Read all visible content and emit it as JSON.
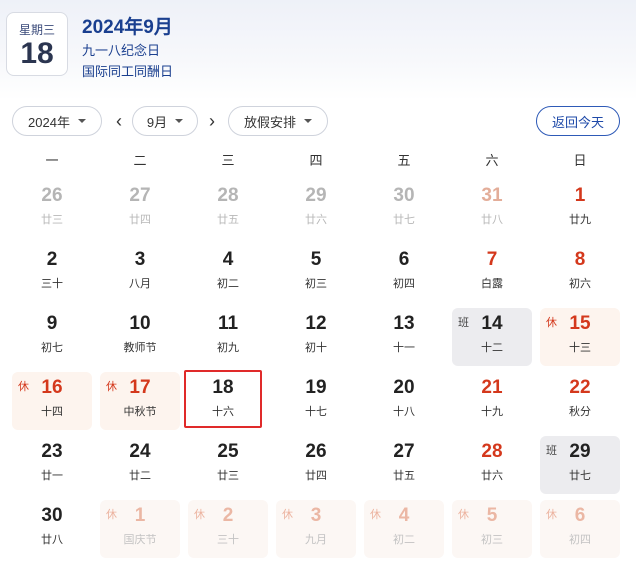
{
  "header": {
    "weekday": "星期三",
    "day": "18",
    "title": "2024年9月",
    "events": [
      "九一八纪念日",
      "国际同工同酬日"
    ]
  },
  "controls": {
    "year": "2024年",
    "month": "9月",
    "holiday": "放假安排",
    "prev": "‹",
    "next": "›",
    "today_button": "返回今天"
  },
  "weekdays": [
    "一",
    "二",
    "三",
    "四",
    "五",
    "六",
    "日"
  ],
  "days": [
    {
      "n": "26",
      "s": "廿三",
      "type": "other"
    },
    {
      "n": "27",
      "s": "廿四",
      "type": "other"
    },
    {
      "n": "28",
      "s": "廿五",
      "type": "other"
    },
    {
      "n": "29",
      "s": "廿六",
      "type": "other"
    },
    {
      "n": "30",
      "s": "廿七",
      "type": "other"
    },
    {
      "n": "31",
      "s": "廿八",
      "type": "other red"
    },
    {
      "n": "1",
      "s": "廿九",
      "type": "red"
    },
    {
      "n": "2",
      "s": "三十",
      "type": ""
    },
    {
      "n": "3",
      "s": "八月",
      "type": ""
    },
    {
      "n": "4",
      "s": "初二",
      "type": ""
    },
    {
      "n": "5",
      "s": "初三",
      "type": ""
    },
    {
      "n": "6",
      "s": "初四",
      "type": ""
    },
    {
      "n": "7",
      "s": "白露",
      "type": "red"
    },
    {
      "n": "8",
      "s": "初六",
      "type": "red"
    },
    {
      "n": "9",
      "s": "初七",
      "type": ""
    },
    {
      "n": "10",
      "s": "教师节",
      "type": ""
    },
    {
      "n": "11",
      "s": "初九",
      "type": ""
    },
    {
      "n": "12",
      "s": "初十",
      "type": ""
    },
    {
      "n": "13",
      "s": "十一",
      "type": ""
    },
    {
      "n": "14",
      "s": "十二",
      "type": "work",
      "tag": "班"
    },
    {
      "n": "15",
      "s": "十三",
      "type": "rest",
      "tag": "休"
    },
    {
      "n": "16",
      "s": "十四",
      "type": "rest",
      "tag": "休"
    },
    {
      "n": "17",
      "s": "中秋节",
      "type": "rest",
      "tag": "休"
    },
    {
      "n": "18",
      "s": "十六",
      "type": "today"
    },
    {
      "n": "19",
      "s": "十七",
      "type": ""
    },
    {
      "n": "20",
      "s": "十八",
      "type": ""
    },
    {
      "n": "21",
      "s": "十九",
      "type": "red"
    },
    {
      "n": "22",
      "s": "秋分",
      "type": "red"
    },
    {
      "n": "23",
      "s": "廿一",
      "type": ""
    },
    {
      "n": "24",
      "s": "廿二",
      "type": ""
    },
    {
      "n": "25",
      "s": "廿三",
      "type": ""
    },
    {
      "n": "26",
      "s": "廿四",
      "type": ""
    },
    {
      "n": "27",
      "s": "廿五",
      "type": ""
    },
    {
      "n": "28",
      "s": "廿六",
      "type": "red"
    },
    {
      "n": "29",
      "s": "廿七",
      "type": "work",
      "tag": "班"
    },
    {
      "n": "30",
      "s": "廿八",
      "type": ""
    },
    {
      "n": "1",
      "s": "国庆节",
      "type": "rest other",
      "tag": "休"
    },
    {
      "n": "2",
      "s": "三十",
      "type": "rest other",
      "tag": "休"
    },
    {
      "n": "3",
      "s": "九月",
      "type": "rest other",
      "tag": "休"
    },
    {
      "n": "4",
      "s": "初二",
      "type": "rest other",
      "tag": "休"
    },
    {
      "n": "5",
      "s": "初三",
      "type": "rest other",
      "tag": "休"
    },
    {
      "n": "6",
      "s": "初四",
      "type": "rest other",
      "tag": "休"
    }
  ]
}
